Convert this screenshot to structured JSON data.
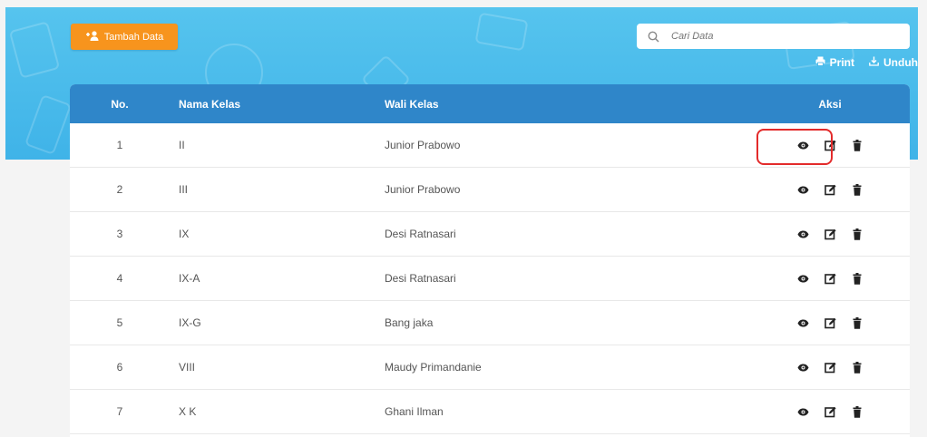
{
  "toolbar": {
    "add_button_label": "Tambah Data",
    "search_placeholder": "Cari Data",
    "print_label": "Print",
    "download_label": "Unduh"
  },
  "table": {
    "headers": [
      "No.",
      "Nama Kelas",
      "Wali Kelas",
      "Aksi"
    ],
    "rows": [
      {
        "no": "1",
        "kelas": "II",
        "wali": "Junior Prabowo"
      },
      {
        "no": "2",
        "kelas": "III",
        "wali": "Junior Prabowo"
      },
      {
        "no": "3",
        "kelas": "IX",
        "wali": "Desi Ratnasari"
      },
      {
        "no": "4",
        "kelas": "IX-A",
        "wali": "Desi Ratnasari"
      },
      {
        "no": "5",
        "kelas": "IX-G",
        "wali": "Bang jaka"
      },
      {
        "no": "6",
        "kelas": "VIII",
        "wali": "Maudy Primandanie"
      },
      {
        "no": "7",
        "kelas": "X K",
        "wali": "Ghani Ilman"
      }
    ],
    "row_actions": [
      "eye-icon",
      "edit-icon",
      "trash-icon"
    ]
  },
  "colors": {
    "banner": "#4bbdec",
    "header": "#2f86c9",
    "add_button": "#f7941d",
    "highlight": "#e32b2b"
  }
}
